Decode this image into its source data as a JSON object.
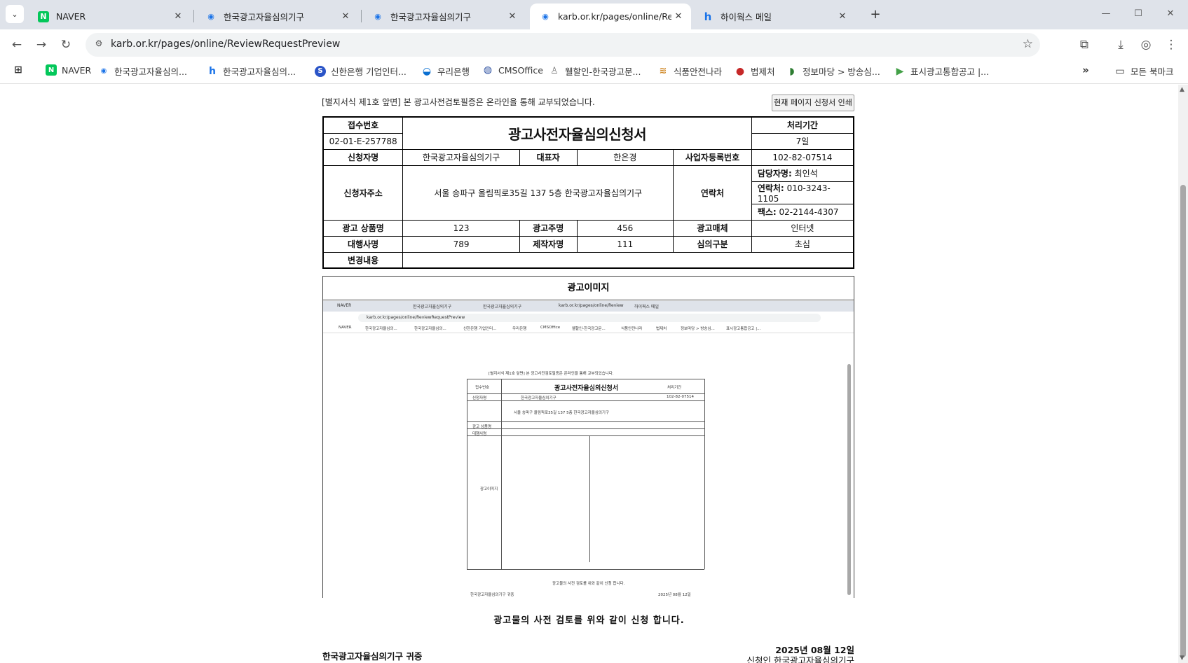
{
  "browser": {
    "tabs": [
      {
        "label": "NAVER",
        "icon": "naver-icon",
        "active": false
      },
      {
        "label": "한국광고자율심의기구",
        "icon": "karb-icon",
        "active": false
      },
      {
        "label": "한국광고자율심의기구",
        "icon": "karb-icon",
        "active": false
      },
      {
        "label": "karb.or.kr/pages/online/Review",
        "icon": "karb-icon",
        "active": true
      },
      {
        "label": "하이웍스 메일",
        "icon": "hiworks-icon",
        "active": false
      }
    ],
    "url": "karb.or.kr/pages/online/ReviewRequestPreview",
    "bookmarks": [
      {
        "label": "NAVER",
        "icon": "naver-icon"
      },
      {
        "label": "한국광고자율심의...",
        "icon": "karb-icon"
      },
      {
        "label": "한국광고자율심의...",
        "icon": "hiworks-icon"
      },
      {
        "label": "신한은행 기업인터...",
        "icon": "shinhan-icon"
      },
      {
        "label": "우리은행",
        "icon": "woori-icon"
      },
      {
        "label": "CMSOffice",
        "icon": "cms-icon"
      },
      {
        "label": "웰할인-한국광고문...",
        "icon": "discount-icon"
      },
      {
        "label": "식품안전나라",
        "icon": "food-icon"
      },
      {
        "label": "법제처",
        "icon": "law-icon"
      },
      {
        "label": "정보마당 > 방송심...",
        "icon": "info-icon"
      },
      {
        "label": "표시광고통합공고 |...",
        "icon": "ad-icon"
      }
    ],
    "all_bookmarks": "모든 북마크"
  },
  "page": {
    "notice": "[별지서식 제1호 앞면] 본 광고사전검토필증은 온라인을 통해 교부되었습니다.",
    "print_button": "현재 페이지 신청서 인쇄",
    "form": {
      "receipt_label": "접수번호",
      "receipt_value": "02-01-E-257788",
      "title": "광고사전자율심의신청서",
      "period_label": "처리기간",
      "period_value": "7일",
      "applicant_label": "신청자명",
      "applicant_value": "한국광고자율심의기구",
      "ceo_label": "대표자",
      "ceo_value": "한은경",
      "bizno_label": "사업자등록번호",
      "bizno_value": "102-82-07514",
      "address_label": "신청자주소",
      "address_value": "서울 송파구 올림픽로35길 137 5층 한국광고자율심의기구",
      "contact_label": "연락처",
      "manager_label": "담당자명:",
      "manager_value": "최인석",
      "phone_label": "연락처:",
      "phone_value": "010-3243-1105",
      "fax_label": "팩스:",
      "fax_value": "02-2144-4307",
      "product_label": "광고 상품명",
      "product_value": "123",
      "advertiser_label": "광고주명",
      "advertiser_value": "456",
      "media_label": "광고매체",
      "media_value": "인터넷",
      "agency_label": "대행사명",
      "agency_value": "789",
      "producer_label": "제작자명",
      "producer_value": "111",
      "review_label": "심의구분",
      "review_value": "초심",
      "change_label": "변경내용",
      "change_value": ""
    },
    "image_title": "광고이미지",
    "declaration": "광고물의 사전 검토를 위와 같이 신청 합니다.",
    "date": "2025년 08월 12일",
    "applicant_sign": "신청인 한국광고자율심의기구",
    "recipient": "한국광고자율심의기구 귀중"
  },
  "colors": {
    "tabstrip": "#dfe3ea",
    "naver_green": "#03c75a",
    "karb_blue": "#1a73e8"
  }
}
